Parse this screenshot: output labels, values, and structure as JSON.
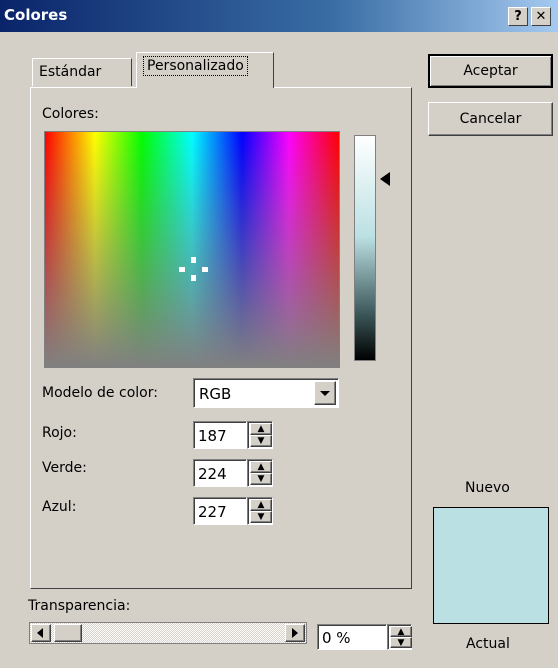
{
  "window": {
    "title": "Colores",
    "help_label": "?",
    "close_label": "✕"
  },
  "tabs": {
    "standard": "Estándar",
    "custom": "Personalizado"
  },
  "buttons": {
    "ok": "Aceptar",
    "cancel": "Cancelar"
  },
  "labels": {
    "colors": "Colores:",
    "color_model": "Modelo de color:",
    "red": "Rojo:",
    "green": "Verde:",
    "blue": "Azul:",
    "transparency": "Transparencia:",
    "new": "Nuevo",
    "current": "Actual"
  },
  "values": {
    "color_model": "RGB",
    "red": "187",
    "green": "224",
    "blue": "227",
    "transparency": "0 %"
  },
  "colors": {
    "new_swatch": "#bbe0e3"
  },
  "icons": [
    "help-icon",
    "close-icon",
    "crosshair-icon",
    "slider-arrow-icon",
    "dropdown-arrow-icon",
    "spin-up-icon",
    "spin-down-icon",
    "scroll-left-icon",
    "scroll-right-icon"
  ]
}
